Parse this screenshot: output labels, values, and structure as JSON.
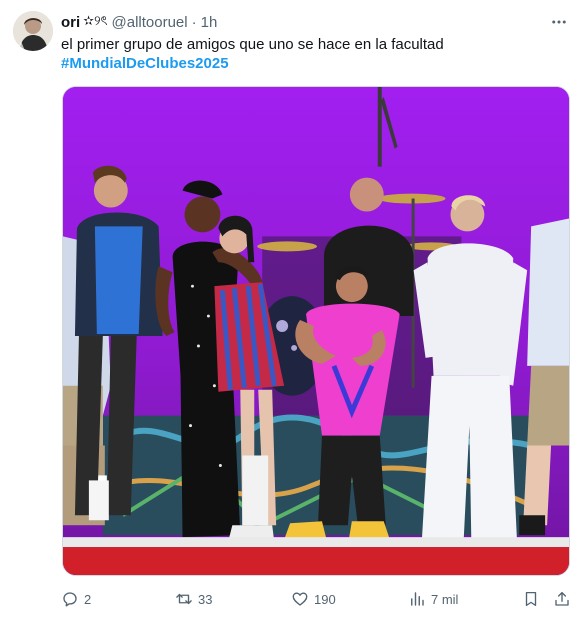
{
  "tweet": {
    "author": {
      "display_name": "ori",
      "name_decoration": "✫୨ৎ",
      "handle": "@alltooruel"
    },
    "separator": "·",
    "timestamp": "1h",
    "text": "el primer grupo de amigos que uno se hace en la facultad",
    "hashtag": "#MundialDeClubes2025",
    "media": {
      "type": "photo",
      "description_icon": "stage-photo"
    },
    "actions": {
      "reply": {
        "icon": "reply-icon",
        "count": "2"
      },
      "retweet": {
        "icon": "retweet-icon",
        "count": "33"
      },
      "like": {
        "icon": "heart-icon",
        "count": "190"
      },
      "views": {
        "icon": "views-icon",
        "count": "7 mil"
      },
      "bookmark": {
        "icon": "bookmark-icon"
      },
      "share": {
        "icon": "share-icon"
      }
    }
  },
  "colors": {
    "text": "#0f1419",
    "secondary": "#536471",
    "link": "#1d9bf0",
    "stage_backdrop": "#9a1fd3",
    "stage_floor": "#d1202a"
  }
}
